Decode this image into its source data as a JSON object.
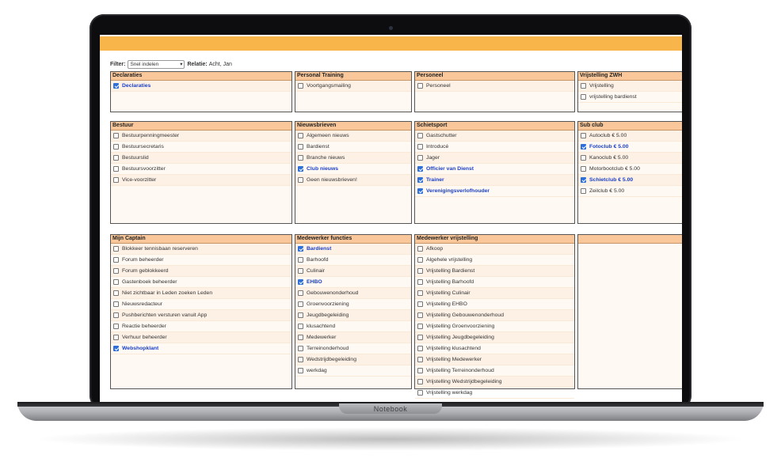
{
  "device": {
    "label": "Notebook"
  },
  "filter": {
    "label": "Filter:",
    "value": "Snel indelen",
    "relatie_label": "Relatie:",
    "relatie_value": "Acht, Jan"
  },
  "panels": [
    {
      "title": "Declaraties",
      "options": [
        {
          "label": "Declaraties",
          "checked": true
        }
      ]
    },
    {
      "title": "Personal Training",
      "options": [
        {
          "label": "Voortgangsmailing",
          "checked": false
        }
      ]
    },
    {
      "title": "Personeel",
      "options": [
        {
          "label": "Personeel",
          "checked": false
        }
      ]
    },
    {
      "title": "Vrijstelling ZWH",
      "options": [
        {
          "label": "Vrijstelling",
          "checked": false
        },
        {
          "label": "vrijstelling bardienst",
          "checked": false
        }
      ]
    },
    {
      "title": "Bestuur",
      "options": [
        {
          "label": "Bestuurpenningmeester",
          "checked": false
        },
        {
          "label": "Bestuursecretaris",
          "checked": false
        },
        {
          "label": "Bestuurslid",
          "checked": false
        },
        {
          "label": "Bestuursvoorzitter",
          "checked": false
        },
        {
          "label": "Vice-voorzitter",
          "checked": false
        }
      ]
    },
    {
      "title": "Nieuwsbrieven",
      "options": [
        {
          "label": "Algemeen nieuws",
          "checked": false
        },
        {
          "label": "Bardienst",
          "checked": false
        },
        {
          "label": "Branche nieuws",
          "checked": false
        },
        {
          "label": "Club nieuws",
          "checked": true
        },
        {
          "label": "Geen nieuwsbrieven!",
          "checked": false
        }
      ]
    },
    {
      "title": "Schietsport",
      "options": [
        {
          "label": "Gastschutter",
          "checked": false
        },
        {
          "label": "Introducé",
          "checked": false
        },
        {
          "label": "Jager",
          "checked": false
        },
        {
          "label": "Officier van Dienst",
          "checked": true
        },
        {
          "label": "Trainer",
          "checked": true
        },
        {
          "label": "Verenigingsverlofhouder",
          "checked": true
        }
      ]
    },
    {
      "title": "Sub club",
      "options": [
        {
          "label": "Autoclub € 5.00",
          "checked": false
        },
        {
          "label": "Fotoclub € 5.00",
          "checked": true
        },
        {
          "label": "Kanoclub € 5.00",
          "checked": false
        },
        {
          "label": "Motorbootclub € 5.00",
          "checked": false
        },
        {
          "label": "Schietclub € 5.00",
          "checked": true
        },
        {
          "label": "Zeilclub € 5.00",
          "checked": false
        }
      ]
    },
    {
      "title": "Mijn Captain",
      "options": [
        {
          "label": "Blokkeer tennisbaan reserveren",
          "checked": false
        },
        {
          "label": "Forum beheerder",
          "checked": false
        },
        {
          "label": "Forum geblokkeerd",
          "checked": false
        },
        {
          "label": "Gastenboek beheerder",
          "checked": false
        },
        {
          "label": "Niet zichtbaar in Leden zoeken Leden",
          "checked": false
        },
        {
          "label": "Nieuwsredacteur",
          "checked": false
        },
        {
          "label": "Pushberichten versturen vanuit App",
          "checked": false
        },
        {
          "label": "Reactie beheerder",
          "checked": false
        },
        {
          "label": "Verhuur beheerder",
          "checked": false
        },
        {
          "label": "Webshopklant",
          "checked": true
        }
      ]
    },
    {
      "title": "Medewerker functies",
      "options": [
        {
          "label": "Bardienst",
          "checked": true
        },
        {
          "label": "Barhoofd",
          "checked": false
        },
        {
          "label": "Culinair",
          "checked": false
        },
        {
          "label": "EHBO",
          "checked": true
        },
        {
          "label": "Gebouwenonderhoud",
          "checked": false
        },
        {
          "label": "Groenvoorziening",
          "checked": false
        },
        {
          "label": "Jeugdbegeleiding",
          "checked": false
        },
        {
          "label": "klusachtend",
          "checked": false
        },
        {
          "label": "Medewerker",
          "checked": false
        },
        {
          "label": "Terreinonderhoud",
          "checked": false
        },
        {
          "label": "Wedstrijdbegeleiding",
          "checked": false
        },
        {
          "label": "werkdag",
          "checked": false
        }
      ]
    },
    {
      "title": "Medewerker vrijstelling",
      "options": [
        {
          "label": "Afkoop",
          "checked": false
        },
        {
          "label": "Algehele vrijstelling",
          "checked": false
        },
        {
          "label": "Vrijstelling Bardienst",
          "checked": false
        },
        {
          "label": "Vrijstelling Barhoofd",
          "checked": false
        },
        {
          "label": "Vrijstelling Culinair",
          "checked": false
        },
        {
          "label": "Vrijstelling EHBO",
          "checked": false
        },
        {
          "label": "Vrijstelling Gebouwenonderhoud",
          "checked": false
        },
        {
          "label": "Vrijstelling Groenvoorziening",
          "checked": false
        },
        {
          "label": "Vrijstelling Jeugdbegeleiding",
          "checked": false
        },
        {
          "label": "Vrijstelling klusachtend",
          "checked": false
        },
        {
          "label": "Vrijstelling Medewerker",
          "checked": false
        },
        {
          "label": "Vrijstelling Terreinonderhoud",
          "checked": false
        },
        {
          "label": "Vrijstelling Wedstrijdbegeleiding",
          "checked": false
        },
        {
          "label": "Vrijstelling werkdag",
          "checked": false
        }
      ]
    },
    {
      "title": "",
      "options": []
    }
  ]
}
